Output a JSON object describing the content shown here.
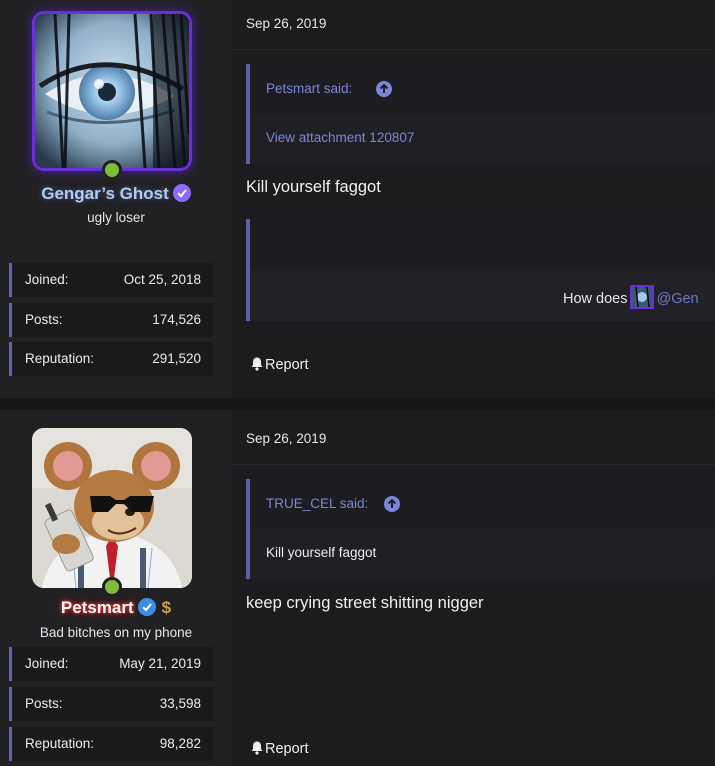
{
  "posts": [
    {
      "user": {
        "name": "Gengar’s Ghost",
        "title": "ugly loser",
        "avatar": "creepy-eye-avatar",
        "badge_color": "#8e6bff",
        "stats": [
          {
            "label": "Joined:",
            "value": "Oct 25, 2018"
          },
          {
            "label": "Posts:",
            "value": "174,526"
          },
          {
            "label": "Reputation:",
            "value": "291,520"
          }
        ]
      },
      "date": "Sep 26, 2019",
      "quote": {
        "attribution": "Petsmart said:",
        "body": "View attachment 120807"
      },
      "message": "Kill yourself faggot",
      "embed": {
        "text": "How does",
        "mention": "@Gen"
      },
      "report_label": "Report"
    },
    {
      "user": {
        "name": "Petsmart",
        "title": "Bad bitches on my phone",
        "avatar": "cartoon-mouse-avatar",
        "badge_color": "#3b8ee8",
        "extra_badge": "$",
        "stats": [
          {
            "label": "Joined:",
            "value": "May 21, 2019"
          },
          {
            "label": "Posts:",
            "value": "33,598"
          },
          {
            "label": "Reputation:",
            "value": "98,282"
          }
        ]
      },
      "date": "Sep 26, 2019",
      "quote": {
        "attribution": "TRUE_CEL said:",
        "body": "Kill yourself faggot"
      },
      "message": "keep crying street shitting nigger",
      "report_label": "Report"
    }
  ],
  "colors": {
    "accent": "#5c63b8",
    "link": "#7c86d8",
    "online": "#7dbb3a",
    "ghost_border": "#6a2fd8"
  }
}
